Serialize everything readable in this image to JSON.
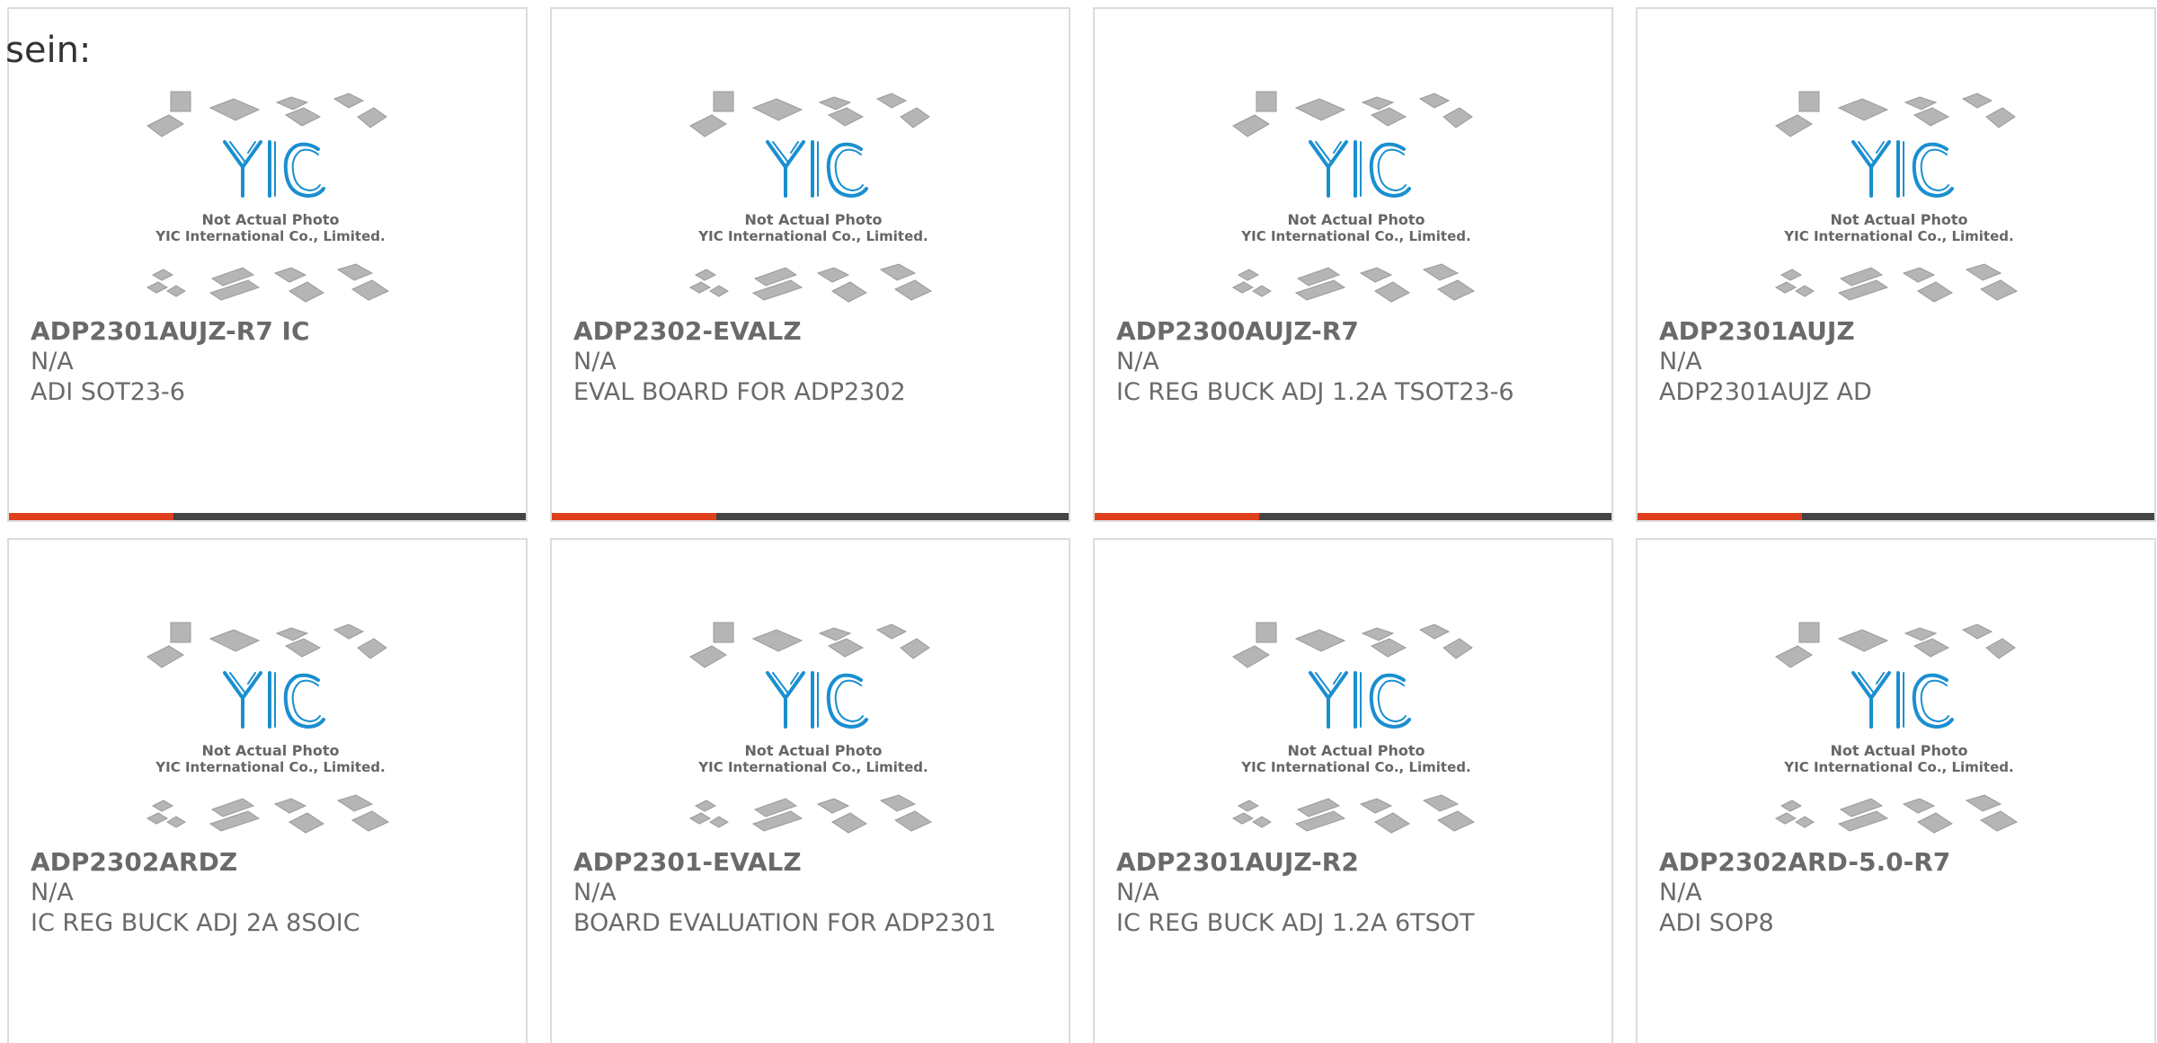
{
  "intro_text": "sein:",
  "photo": {
    "line1": "Not Actual Photo",
    "line2": "YIC International Co., Limited.",
    "logo_text": "YIC",
    "logo_color": "#1a8fd0"
  },
  "colors": {
    "accent": "#e0401c",
    "bar": "#444444",
    "border": "#dcdcdc",
    "text": "#6a6a6a"
  },
  "products": [
    {
      "part_number": "ADP2301AUJZ-R7 IC",
      "manufacturer": "N/A",
      "description": "ADI SOT23-6"
    },
    {
      "part_number": "ADP2302-EVALZ",
      "manufacturer": "N/A",
      "description": "EVAL BOARD FOR ADP2302"
    },
    {
      "part_number": "ADP2300AUJZ-R7",
      "manufacturer": "N/A",
      "description": "IC REG BUCK ADJ 1.2A TSOT23-6"
    },
    {
      "part_number": "ADP2301AUJZ",
      "manufacturer": "N/A",
      "description": "ADP2301AUJZ AD"
    },
    {
      "part_number": "ADP2302ARDZ",
      "manufacturer": "N/A",
      "description": "IC REG BUCK ADJ 2A 8SOIC"
    },
    {
      "part_number": "ADP2301-EVALZ",
      "manufacturer": "N/A",
      "description": "BOARD EVALUATION FOR ADP2301"
    },
    {
      "part_number": "ADP2301AUJZ-R2",
      "manufacturer": "N/A",
      "description": "IC REG BUCK ADJ 1.2A 6TSOT"
    },
    {
      "part_number": "ADP2302ARD-5.0-R7",
      "manufacturer": "N/A",
      "description": "ADI SOP8"
    }
  ]
}
